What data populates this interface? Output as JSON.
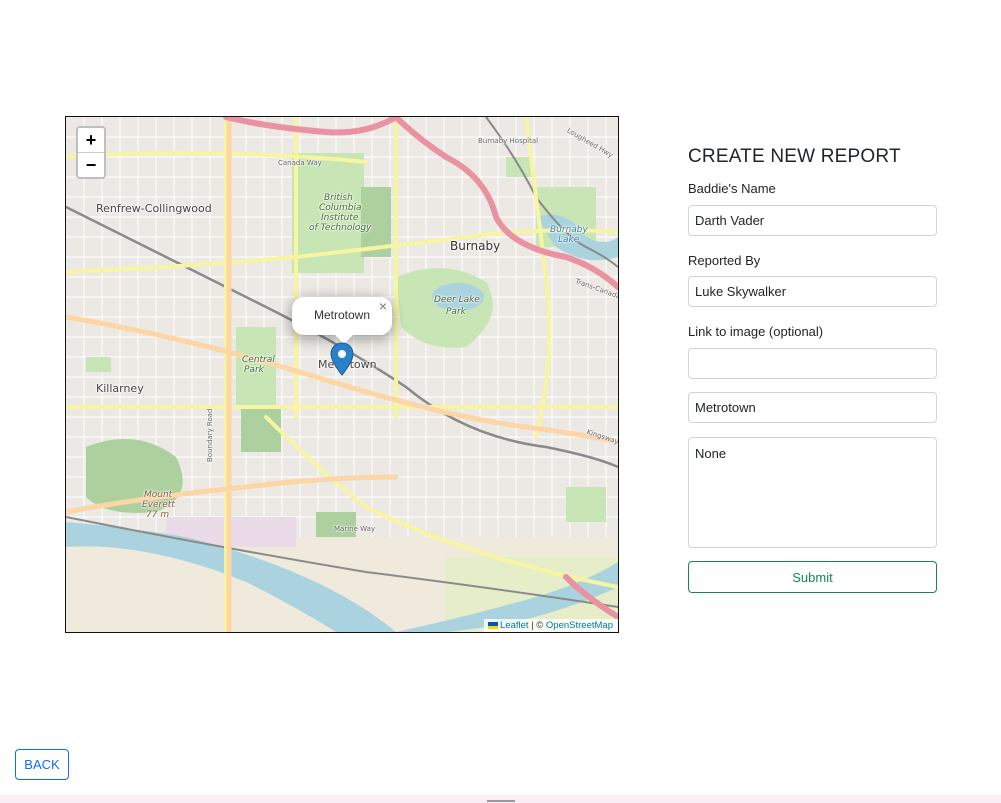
{
  "map": {
    "zoom_in": "+",
    "zoom_out": "−",
    "popup": {
      "text": "Metrotown",
      "close": "×"
    },
    "attribution": {
      "leaflet": "Leaflet",
      "separator": " | © ",
      "osm": "OpenStreetMap"
    },
    "labels": {
      "renfrew": "Renfrew-Collingwood",
      "burnaby": "Burnaby",
      "bcit_1": "British",
      "bcit_2": "Columbia",
      "bcit_3": "Institute",
      "bcit_4": "of Technology",
      "deer_lake_1": "Deer Lake",
      "deer_lake_2": "Park",
      "central_park_1": "Central",
      "central_park_2": "Park",
      "metrotown": "Metrotown",
      "killarney": "Killarney",
      "mount_everett_1": "Mount",
      "mount_everett_2": "Everett",
      "mount_everett_3": "77 m",
      "canada_way": "Canada Way",
      "burnaby_lake_1": "Burnaby",
      "burnaby_lake_2": "Lake",
      "boundary_road": "Boundary Road",
      "marine_way": "Marine Way",
      "kingsway": "Kingsway",
      "trans_canada": "Trans-Canada",
      "lougheed": "Lougheed Hwy",
      "burnaby_hospital": "Burnaby Hospital"
    }
  },
  "form": {
    "title": "CREATE NEW REPORT",
    "baddie_label": "Baddie's Name",
    "baddie_value": "Darth Vader",
    "reporter_label": "Reported By",
    "reporter_value": "Luke Skywalker",
    "image_label": "Link to image (optional)",
    "image_value": "",
    "location_value": "Metrotown",
    "description_value": "None",
    "submit_label": "Submit"
  },
  "back_label": "BACK",
  "colors": {
    "submit": "#198754",
    "back": "#0d6efd",
    "marker": "#2a81cb"
  }
}
